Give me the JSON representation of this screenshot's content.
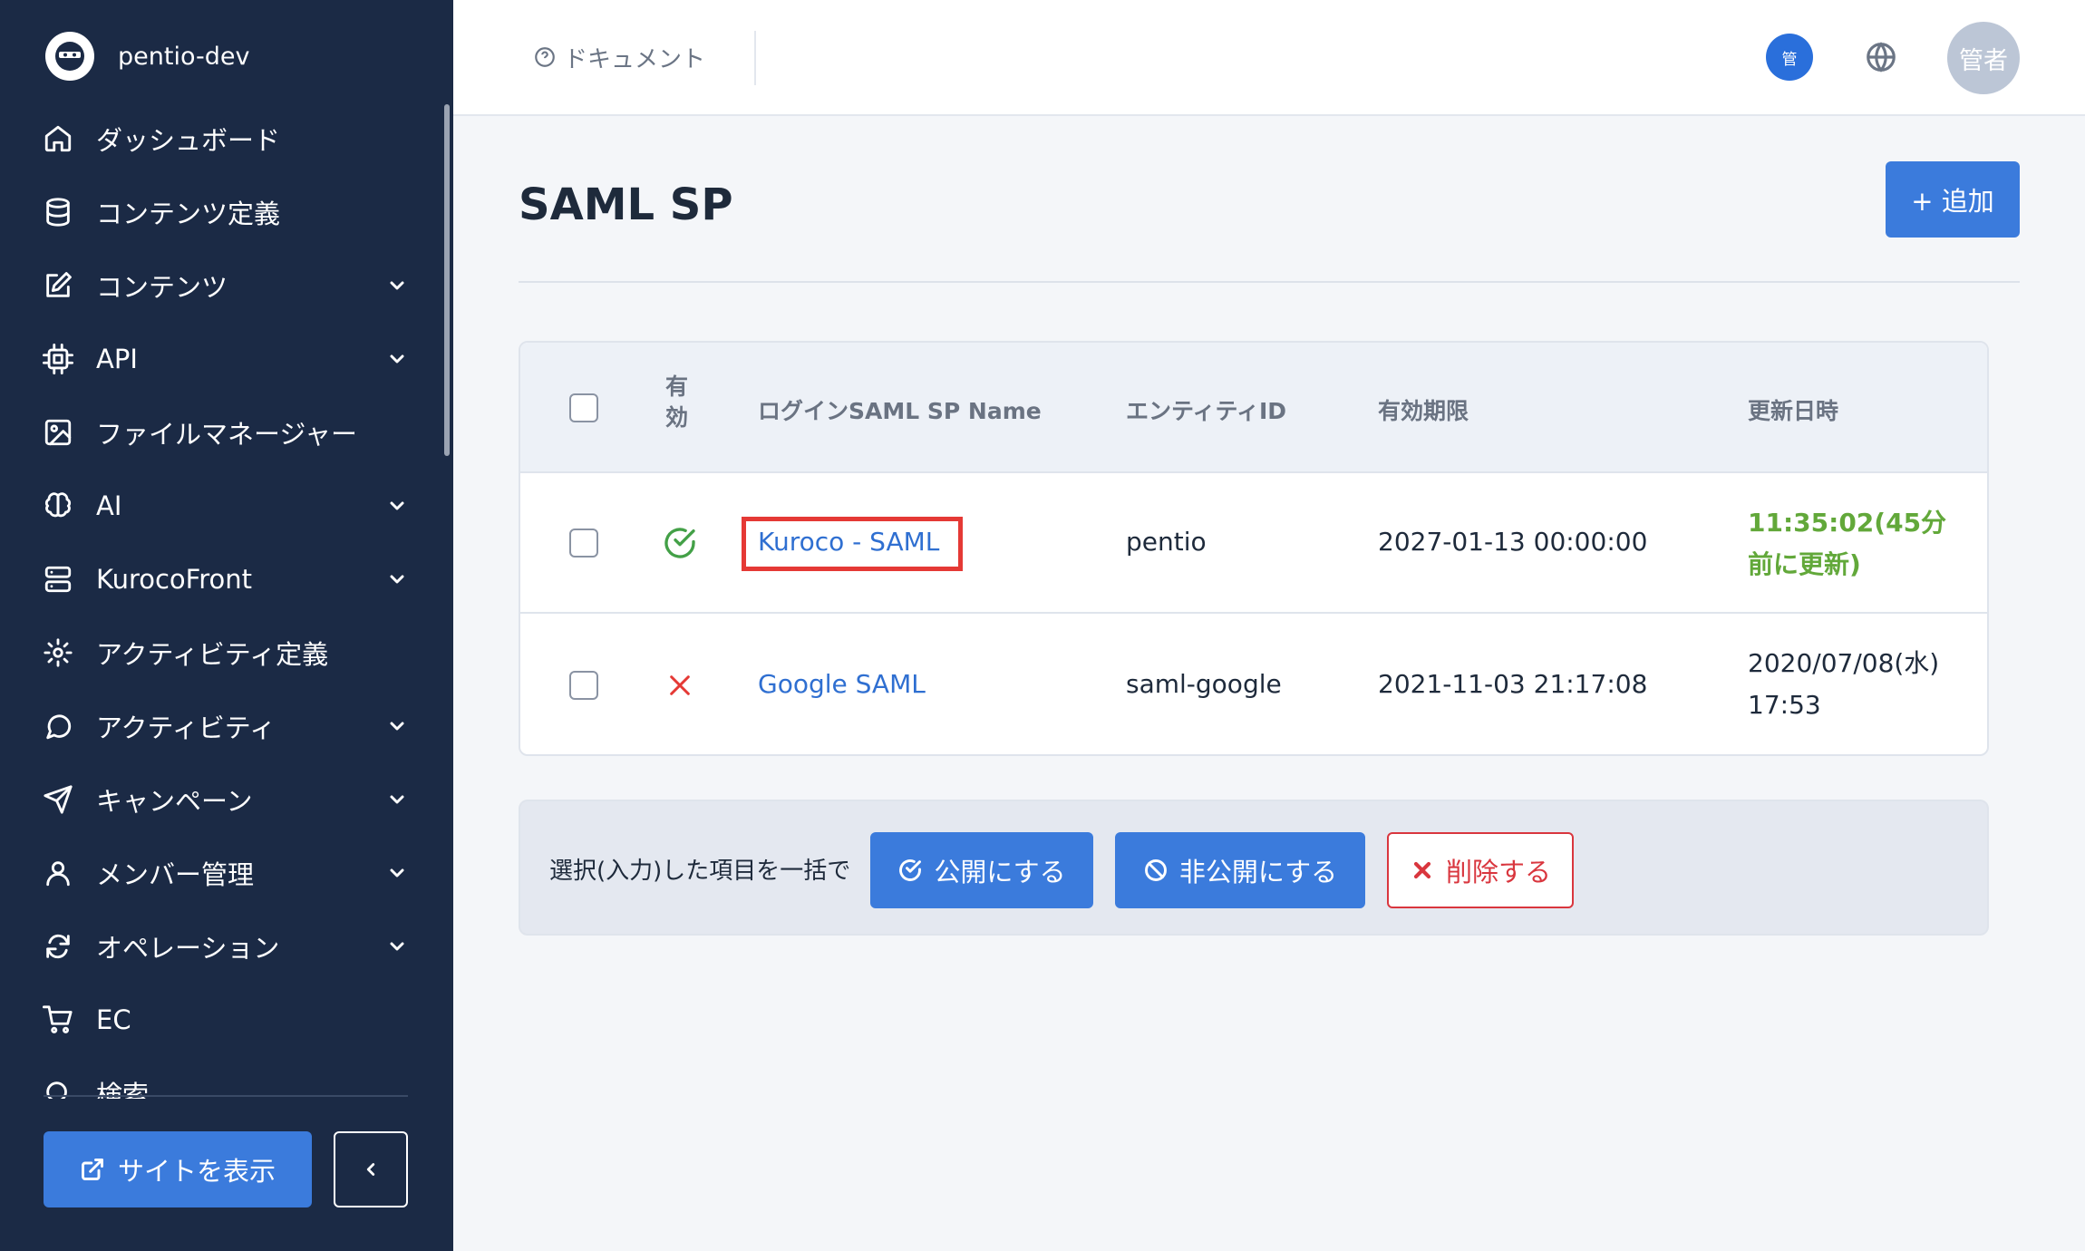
{
  "sidebar": {
    "brand": "pentio-dev",
    "items": [
      {
        "label": "ダッシュボード",
        "icon": "home-icon",
        "expandable": false
      },
      {
        "label": "コンテンツ定義",
        "icon": "database-icon",
        "expandable": false
      },
      {
        "label": "コンテンツ",
        "icon": "edit-icon",
        "expandable": true
      },
      {
        "label": "API",
        "icon": "cpu-icon",
        "expandable": true
      },
      {
        "label": "ファイルマネージャー",
        "icon": "image-icon",
        "expandable": false
      },
      {
        "label": "AI",
        "icon": "brain-icon",
        "expandable": true
      },
      {
        "label": "KurocoFront",
        "icon": "server-icon",
        "expandable": true
      },
      {
        "label": "アクティビティ定義",
        "icon": "gear-icon",
        "expandable": false
      },
      {
        "label": "アクティビティ",
        "icon": "chat-icon",
        "expandable": true
      },
      {
        "label": "キャンペーン",
        "icon": "send-icon",
        "expandable": true
      },
      {
        "label": "メンバー管理",
        "icon": "user-icon",
        "expandable": true
      },
      {
        "label": "オペレーション",
        "icon": "refresh-icon",
        "expandable": true
      },
      {
        "label": "EC",
        "icon": "cart-icon",
        "expandable": false
      },
      {
        "label": "検索",
        "icon": "search-icon",
        "expandable": false
      }
    ],
    "site_button": "サイトを表示",
    "collapse_icon": "chevron-left-icon"
  },
  "topbar": {
    "doc_link": "ドキュメント",
    "admin_badge": "管",
    "avatar_text": "管者"
  },
  "page": {
    "title": "SAML SP",
    "add_button": "+ 追加"
  },
  "table": {
    "headers": {
      "valid_line1": "有",
      "valid_line2": "効",
      "name": "ログインSAML SP Name",
      "entity": "エンティティID",
      "expiry": "有効期限",
      "updated": "更新日時"
    },
    "rows": [
      {
        "valid": true,
        "name": "Kuroco - SAML",
        "entity": "pentio",
        "expiry": "2027-01-13 00:00:00",
        "updated_line1": "11:35:02(45分",
        "updated_line2": "前に更新)"
      },
      {
        "valid": false,
        "name": "Google SAML",
        "entity": "saml-google",
        "expiry": "2021-11-03 21:17:08",
        "updated_line1": "2020/07/08(水)",
        "updated_line2": "17:53"
      }
    ]
  },
  "bulk": {
    "label": "選択(入力)した項目を一括で",
    "publish": "公開にする",
    "unpublish": "非公開にする",
    "delete": "削除する"
  },
  "colors": {
    "sidebar_bg": "#1b2a45",
    "accent": "#3b7bdc",
    "link": "#2f6fd1",
    "success": "#62a83a",
    "danger": "#d9363e",
    "highlight": "#e53935"
  }
}
